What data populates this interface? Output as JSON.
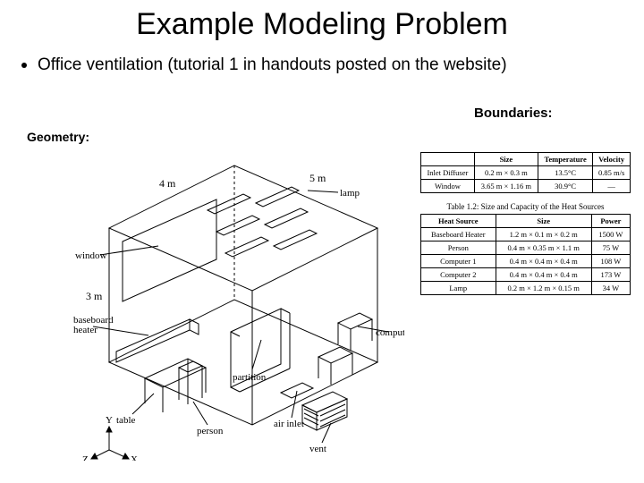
{
  "title": "Example Modeling Problem",
  "bullet_text": "Office ventilation (tutorial 1  in handouts posted on the website)",
  "labels": {
    "geometry": "Geometry:",
    "boundaries": "Boundaries:"
  },
  "geometry": {
    "dim_width": "4 m",
    "dim_depth": "5 m",
    "dim_height": "3 m",
    "annotations": {
      "lamp": "lamp",
      "window": "window",
      "baseboard_heater": "baseboard\nheater",
      "partition": "partition",
      "computer": "computer",
      "table": "table",
      "person": "person",
      "air_inlet": "air inlet",
      "vent": "vent"
    },
    "axes": {
      "x": "X",
      "y": "Y",
      "z": "Z"
    }
  },
  "table1": {
    "headers": [
      "",
      "Size",
      "Temperature",
      "Velocity"
    ],
    "rows": [
      [
        "Inlet Diffuser",
        "0.2 m × 0.3 m",
        "13.5°C",
        "0.85 m/s"
      ],
      [
        "Window",
        "3.65 m × 1.16 m",
        "30.9°C",
        "—"
      ]
    ]
  },
  "table2": {
    "caption": "Table 1.2: Size and Capacity of the Heat Sources",
    "headers": [
      "Heat Source",
      "Size",
      "Power"
    ],
    "rows": [
      [
        "Baseboard Heater",
        "1.2 m × 0.1 m × 0.2 m",
        "1500 W"
      ],
      [
        "Person",
        "0.4 m × 0.35 m × 1.1 m",
        "75 W"
      ],
      [
        "Computer 1",
        "0.4 m × 0.4 m × 0.4 m",
        "108 W"
      ],
      [
        "Computer 2",
        "0.4 m × 0.4 m × 0.4 m",
        "173 W"
      ],
      [
        "Lamp",
        "0.2 m × 1.2 m × 0.15 m",
        "34 W"
      ]
    ]
  }
}
